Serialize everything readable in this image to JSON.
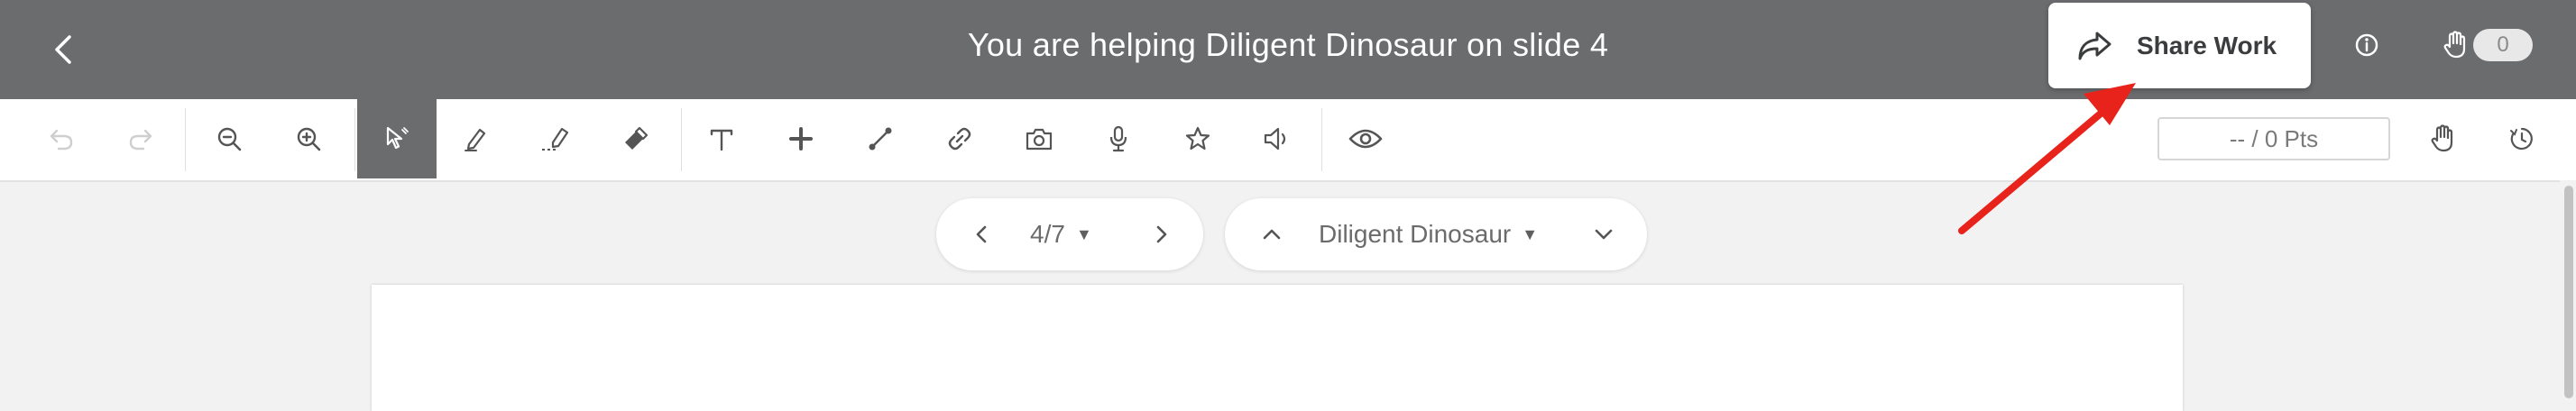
{
  "header": {
    "title": "You are helping Diligent Dinosaur on slide 4",
    "share_label": "Share Work",
    "hand_count": "0"
  },
  "toolbar": {
    "tools": [
      "undo-icon",
      "redo-icon",
      "zoom-out-icon",
      "zoom-in-icon",
      "select-pointer-icon",
      "pen-icon",
      "highlighter-icon",
      "eraser-icon",
      "text-icon",
      "plus-icon",
      "line-icon",
      "link-icon",
      "camera-icon",
      "microphone-icon",
      "star-icon",
      "speaker-icon",
      "eye-icon"
    ],
    "active_tool": "select-pointer-icon",
    "points": "-- / 0 Pts"
  },
  "slide_nav": {
    "current": "4/7"
  },
  "student_nav": {
    "name": "Diligent Dinosaur"
  },
  "colors": {
    "header_bg": "#6b6c6e",
    "arrow": "#e8231c",
    "page_bg": "#f2f2f2"
  }
}
